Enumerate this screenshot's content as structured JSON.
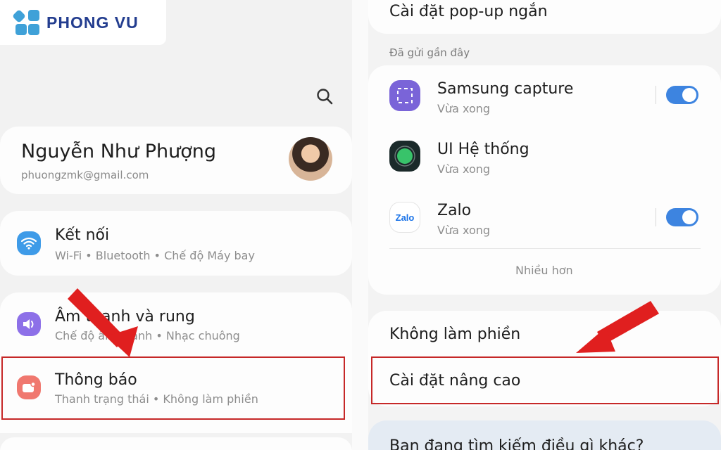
{
  "logo": {
    "brand": "PHONG VU"
  },
  "left": {
    "search_icon": "search-icon",
    "profile": {
      "name": "Nguyễn Như Phượng",
      "email": "phuongzmk@gmail.com"
    },
    "items": [
      {
        "title": "Kết nối",
        "subtitle": "Wi-Fi • Bluetooth • Chế độ Máy bay",
        "icon": "wifi-icon",
        "color": "#3e9be8"
      },
      {
        "title": "Âm thanh và rung",
        "subtitle": "Chế độ âm thanh • Nhạc chuông",
        "icon": "speaker-icon",
        "color": "#8d70e8"
      },
      {
        "title": "Thông báo",
        "subtitle": "Thanh trạng thái • Không làm phiền",
        "icon": "notification-icon",
        "color": "#f0786f"
      }
    ]
  },
  "right": {
    "top_item": "Cài đặt pop-up ngắn",
    "recent_label": "Đã gửi gần đây",
    "apps": [
      {
        "name": "Samsung capture",
        "time": "Vừa xong",
        "toggle": true,
        "icon": "samsung-capture-icon"
      },
      {
        "name": "UI Hệ thống",
        "time": "Vừa xong",
        "toggle": false,
        "icon": "system-ui-icon"
      },
      {
        "name": "Zalo",
        "time": "Vừa xong",
        "toggle": true,
        "icon": "zalo-icon",
        "icon_text": "Zalo"
      }
    ],
    "more": "Nhiều hơn",
    "dnd": "Không làm phiền",
    "advanced": "Cài đặt nâng cao",
    "search_prompt": "Bạn đang tìm kiếm điều gì khác?"
  },
  "colors": {
    "accent": "#3d84e0",
    "highlight": "#c62828",
    "arrow": "#e01f1f"
  }
}
